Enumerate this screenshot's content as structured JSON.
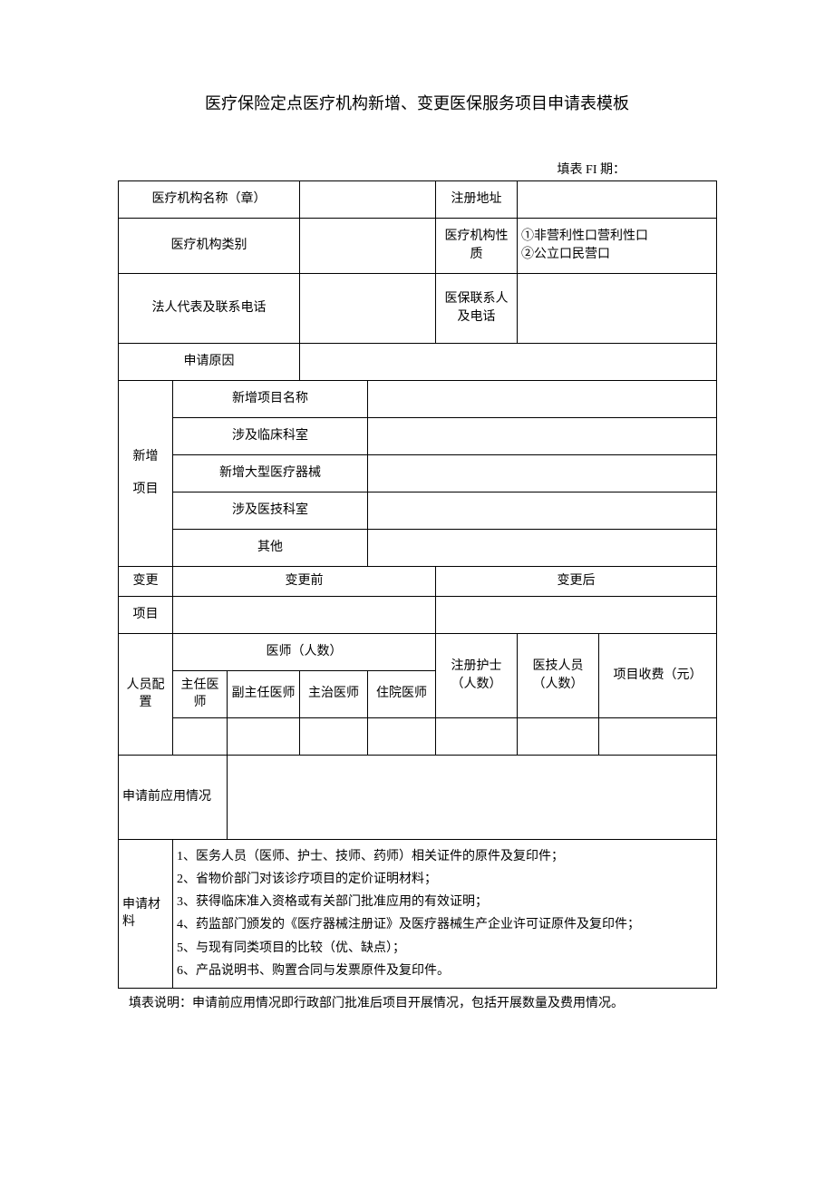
{
  "title": "医疗保险定点医疗机构新增、变更医保服务项目申请表模板",
  "dateLabel": "填表 FI 期：",
  "labels": {
    "orgName": "医疗机构名称（章）",
    "regAddr": "注册地址",
    "orgType": "医疗机构类别",
    "orgNature": "医疗机构性质",
    "natureOptions": "①非营利性口营利性口\n②公立口民营口",
    "legalRep": "法人代表及联系电话",
    "insContact": "医保联系人及电话",
    "reason": "申请原因",
    "newItemGroup": "新增",
    "newItemGroup2": "项目",
    "newItemName": "新增项目名称",
    "clinicalDept": "涉及临床科室",
    "newEquip": "新增大型医疗器械",
    "techDept": "涉及医技科室",
    "other": "其他",
    "changeGroup": "变更",
    "changeGroup2": "项目",
    "before": "变更前",
    "after": "变更后",
    "staffGroup": "人员配置",
    "doctors": "医师（人数）",
    "chief": "主任医师",
    "deputy": "副主任医师",
    "attending": "主治医师",
    "resident": "住院医师",
    "nurses": "注册护士（人数）",
    "techs": "医技人员（人数）",
    "fee": "项目收费（元）",
    "preUse": "申请前应用情况",
    "materials": "申请材料"
  },
  "materialsList": "1、医务人员（医师、护士、技师、药师）相关证件的原件及复印件；\n2、省物价部门对该诊疗项目的定价证明材料；\n3、获得临床准入资格或有关部门批准应用的有效证明；\n4、药监部门颁发的《医疗器械注册证》及医疗器械生产企业许可证原件及复印件；\n5、与现有同类项目的比较（优、缺点）；\n6、产品说明书、购置合同与发票原件及复印件。",
  "footnote": "填表说明：申请前应用情况即行政部门批准后项目开展情况，包括开展数量及费用情况。"
}
